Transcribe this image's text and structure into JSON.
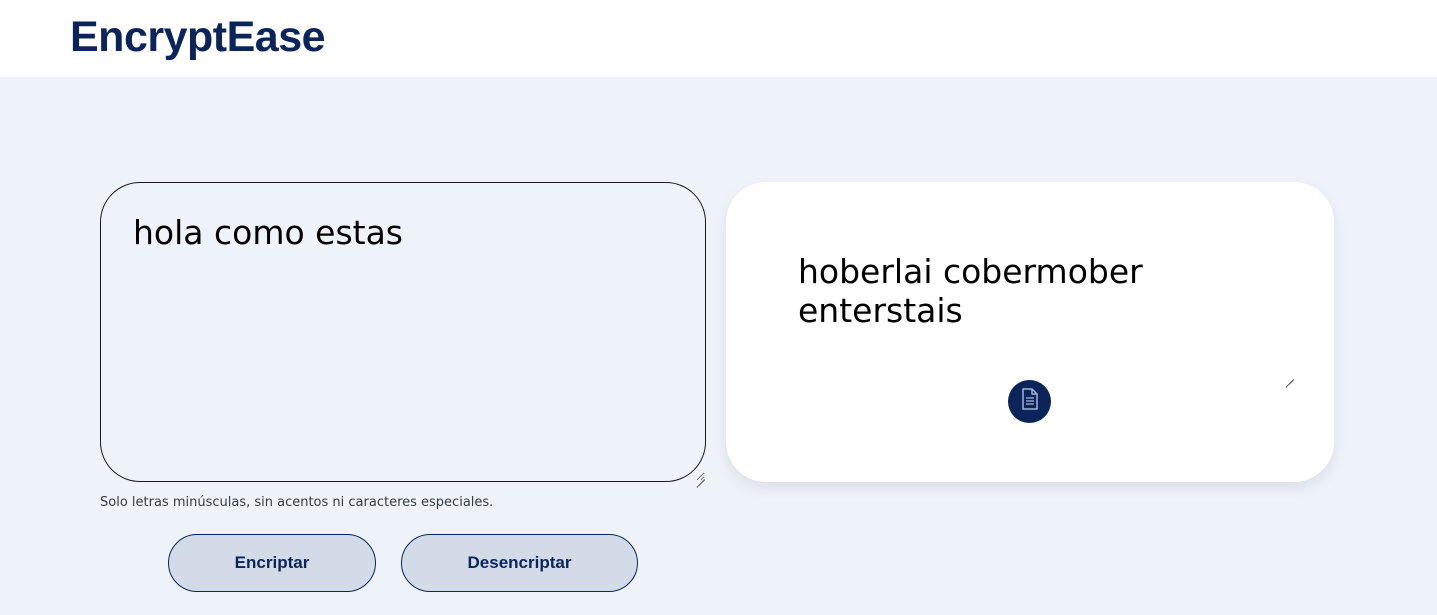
{
  "app": {
    "brand": "EncryptEase"
  },
  "input": {
    "value": "hola como estas",
    "hint": "Solo letras minúsculas, sin acentos ni caracteres especiales."
  },
  "buttons": {
    "encrypt_label": "Encriptar",
    "decrypt_label": "Desencriptar"
  },
  "output": {
    "value": "hoberlai cobermober enterstais",
    "copy_icon": "document-copy-icon"
  },
  "colors": {
    "brand": "#0b2459",
    "page_background": "#eef2f9",
    "button_background": "#d3dbe8",
    "card_background": "#ffffff"
  }
}
